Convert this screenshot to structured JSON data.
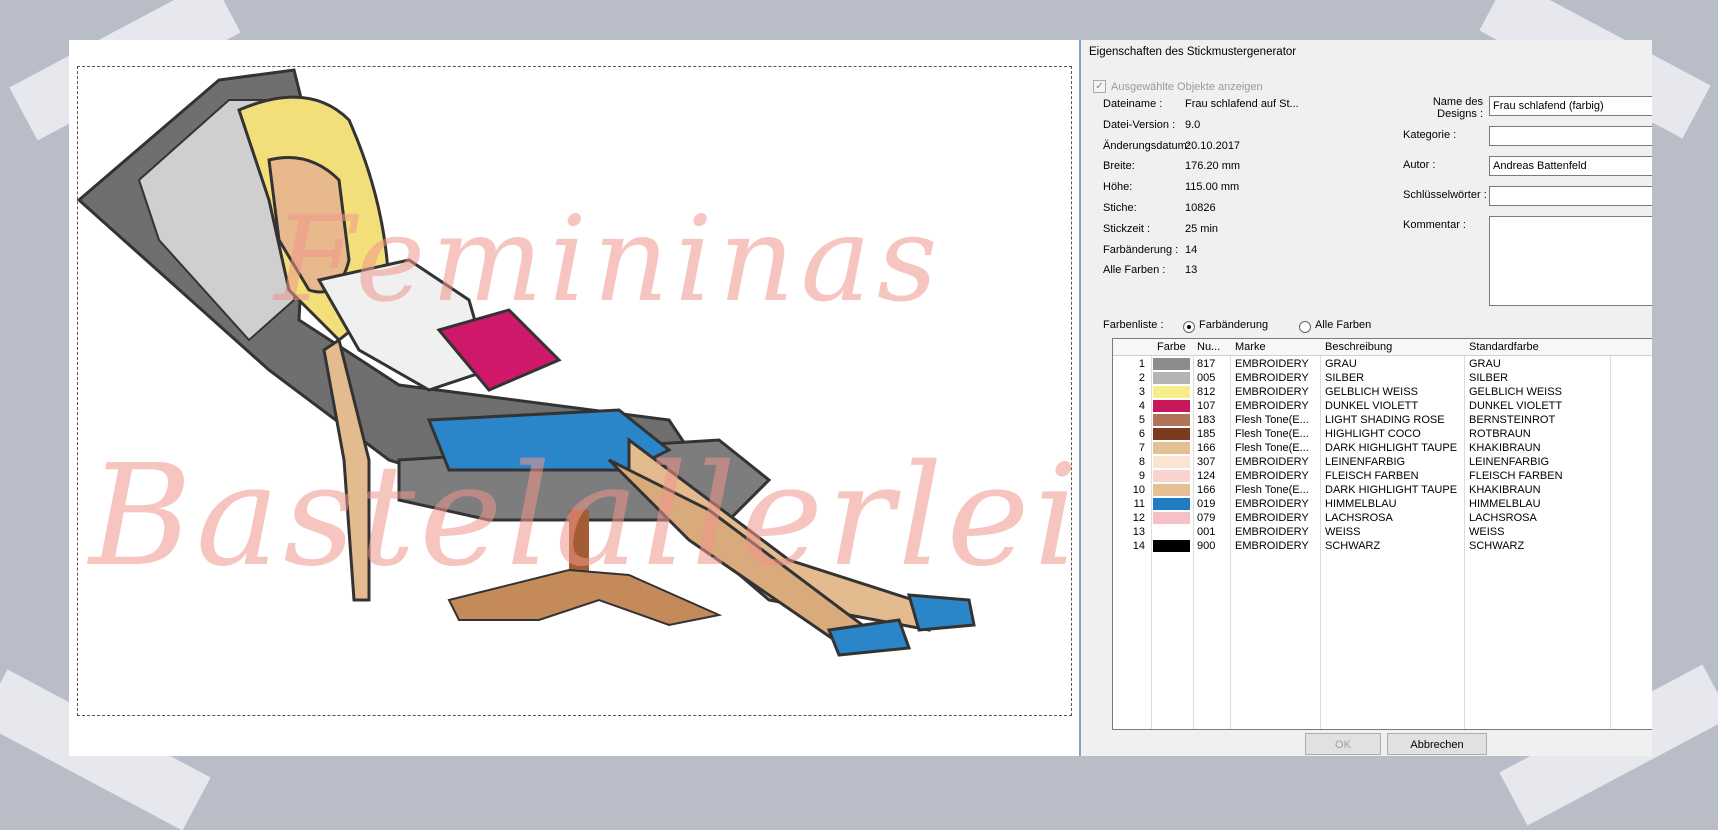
{
  "dialog": {
    "title": "Eigenschaften des Stickmustergenerator",
    "show_selected_label": "Ausgewählte Objekte anzeigen",
    "properties": [
      {
        "label": "Dateiname :",
        "value": "Frau schlafend auf St..."
      },
      {
        "label": "Datei-Version :",
        "value": "9.0"
      },
      {
        "label": "Änderungsdatum:",
        "value": "20.10.2017"
      },
      {
        "label": "Breite:",
        "value": "176.20 mm"
      },
      {
        "label": "Höhe:",
        "value": "115.00 mm"
      },
      {
        "label": "Stiche:",
        "value": "10826"
      },
      {
        "label": "Stickzeit :",
        "value": "25 min"
      },
      {
        "label": "Farbänderung :",
        "value": "14"
      },
      {
        "label": "Alle Farben :",
        "value": "13"
      }
    ],
    "design_name_label": "Name des\nDesigns :",
    "design_name_value": "Frau schlafend (farbig)",
    "category_label": "Kategorie :",
    "category_value": "",
    "author_label": "Autor :",
    "author_value": "Andreas Battenfeld",
    "keywords_label": "Schlüsselwörter :",
    "keywords_value": "",
    "comment_label": "Kommentar :",
    "color_list_label": "Farbenliste :",
    "radio_color_change": "Farbänderung",
    "radio_all_colors": "Alle Farben",
    "radio_selected": "Farbänderung",
    "columns": [
      "Farbe",
      "Nu...",
      "Marke",
      "Beschreibung",
      "Standardfarbe"
    ],
    "rows": [
      {
        "idx": "1",
        "color": "#8c8c8c",
        "num": "817",
        "brand": "EMBROIDERY",
        "desc": "GRAU",
        "std": "GRAU"
      },
      {
        "idx": "2",
        "color": "#b4b4b4",
        "num": "005",
        "brand": "EMBROIDERY",
        "desc": "SILBER",
        "std": "SILBER"
      },
      {
        "idx": "3",
        "color": "#f7ee8a",
        "num": "812",
        "brand": "EMBROIDERY",
        "desc": "GELBLICH WEISS",
        "std": "GELBLICH WEISS"
      },
      {
        "idx": "4",
        "color": "#c8175c",
        "num": "107",
        "brand": "EMBROIDERY",
        "desc": "DUNKEL VIOLETT",
        "std": "DUNKEL VIOLETT"
      },
      {
        "idx": "5",
        "color": "#b07258",
        "num": "183",
        "brand": "Flesh Tone(E...",
        "desc": "LIGHT SHADING ROSE",
        "std": "BERNSTEINROT"
      },
      {
        "idx": "6",
        "color": "#7c3a1e",
        "num": "185",
        "brand": "Flesh Tone(E...",
        "desc": "HIGHLIGHT COCO",
        "std": "ROTBRAUN"
      },
      {
        "idx": "7",
        "color": "#e4c094",
        "num": "166",
        "brand": "Flesh Tone(E...",
        "desc": "DARK HIGHLIGHT TAUPE",
        "std": "KHAKIBRAUN"
      },
      {
        "idx": "8",
        "color": "#fbe4d2",
        "num": "307",
        "brand": "EMBROIDERY",
        "desc": "LEINENFARBIG",
        "std": "LEINENFARBIG"
      },
      {
        "idx": "9",
        "color": "#f8d3cf",
        "num": "124",
        "brand": "EMBROIDERY",
        "desc": "FLEISCH FARBEN",
        "std": "FLEISCH FARBEN"
      },
      {
        "idx": "10",
        "color": "#e4c094",
        "num": "166",
        "brand": "Flesh Tone(E...",
        "desc": "DARK HIGHLIGHT TAUPE",
        "std": "KHAKIBRAUN"
      },
      {
        "idx": "11",
        "color": "#1f7cc0",
        "num": "019",
        "brand": "EMBROIDERY",
        "desc": "HIMMELBLAU",
        "std": "HIMMELBLAU"
      },
      {
        "idx": "12",
        "color": "#f5c0c8",
        "num": "079",
        "brand": "EMBROIDERY",
        "desc": "LACHSROSA",
        "std": "LACHSROSA"
      },
      {
        "idx": "13",
        "color": "#ffffff",
        "num": "001",
        "brand": "EMBROIDERY",
        "desc": "WEISS",
        "std": "WEISS"
      },
      {
        "idx": "14",
        "color": "#000000",
        "num": "900",
        "brand": "EMBROIDERY",
        "desc": "SCHWARZ",
        "std": "SCHWARZ"
      }
    ],
    "ok_label": "OK",
    "cancel_label": "Abbrechen"
  },
  "preview": {
    "watermark_line1": "Femininas",
    "watermark_line2": "Bastelallerlei"
  }
}
